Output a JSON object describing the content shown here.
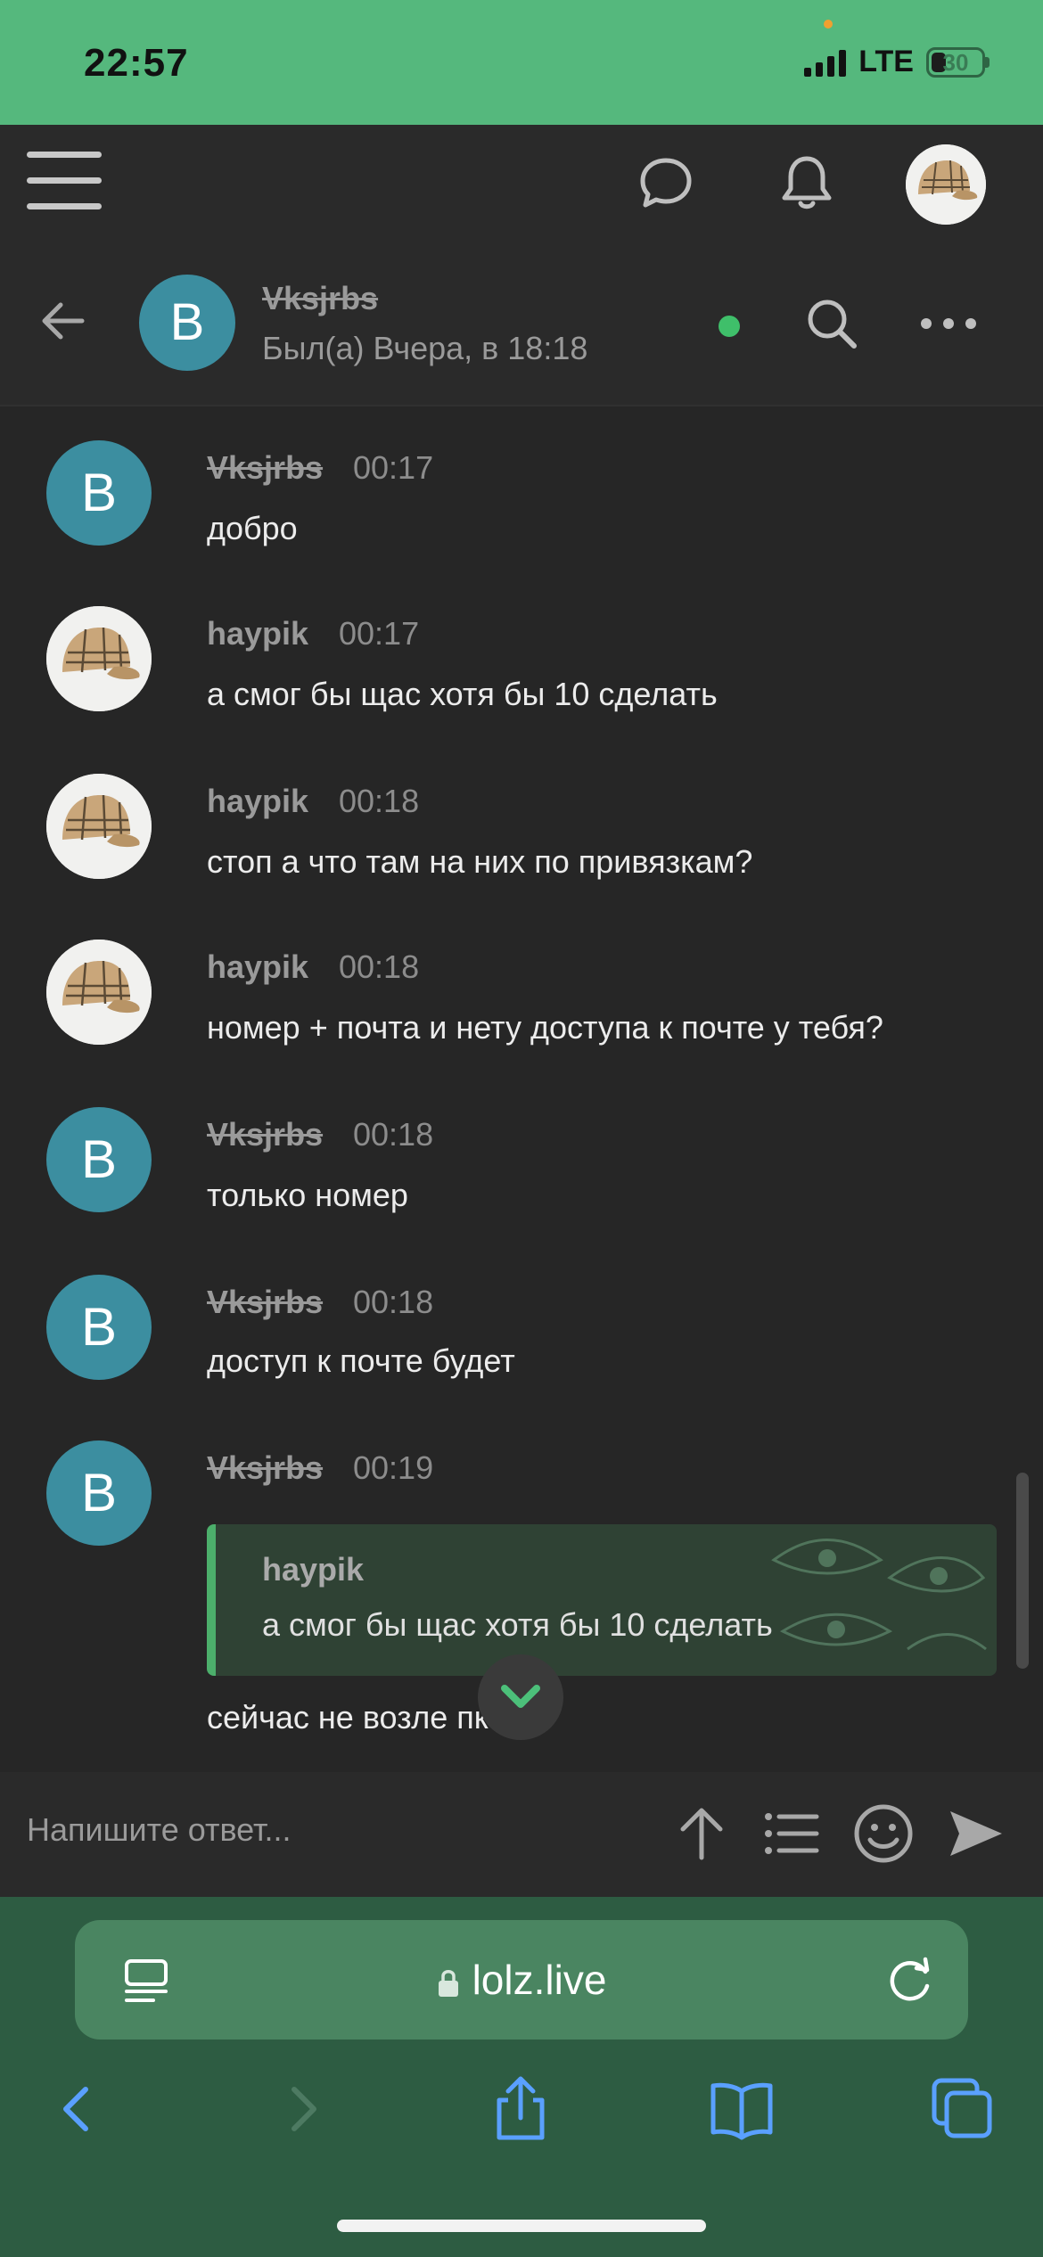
{
  "status_bar": {
    "time": "22:57",
    "network": "LTE",
    "battery": "30",
    "battery_level": 0.3,
    "colors": {
      "background": "#55b87d"
    }
  },
  "app_header": {
    "menu_icon": "hamburger-icon",
    "chat_icon": "speech-bubble-icon",
    "notifications_icon": "bell-icon",
    "profile_avatar": "cap-avatar"
  },
  "chat_header": {
    "avatar_letter": "B",
    "name": "Vksjrbs",
    "last_seen": "Был(а) Вчера, в 18:18",
    "online": true,
    "search_icon": "search-icon",
    "more_icon": "more-dots-icon"
  },
  "messages": [
    {
      "author": "Vksjrbs",
      "avatar": "letter",
      "avatar_letter": "B",
      "strikethrough": true,
      "time": "00:17",
      "text": "добро"
    },
    {
      "author": "haypik",
      "avatar": "cap",
      "strikethrough": false,
      "time": "00:17",
      "text": "а смог бы щас хотя бы 10 сделать"
    },
    {
      "author": "haypik",
      "avatar": "cap",
      "strikethrough": false,
      "time": "00:18",
      "text": "стоп а что там на них по привязкам?"
    },
    {
      "author": "haypik",
      "avatar": "cap",
      "strikethrough": false,
      "time": "00:18",
      "text": "номер + почта и нету доступа к почте у тебя?"
    },
    {
      "author": "Vksjrbs",
      "avatar": "letter",
      "avatar_letter": "B",
      "strikethrough": true,
      "time": "00:18",
      "text": "только номер"
    },
    {
      "author": "Vksjrbs",
      "avatar": "letter",
      "avatar_letter": "B",
      "strikethrough": true,
      "time": "00:18",
      "text": "доступ к почте будет"
    },
    {
      "author": "Vksjrbs",
      "avatar": "letter",
      "avatar_letter": "B",
      "strikethrough": true,
      "time": "00:19",
      "quote": {
        "author": "haypik",
        "text": "а смог бы щас хотя бы 10 сделать"
      },
      "text": "сейчас не возле пк"
    }
  ],
  "reply_bar": {
    "placeholder": "Напишите ответ...",
    "icons": [
      "upload-arrow-icon",
      "list-icon",
      "smiley-icon",
      "send-icon"
    ]
  },
  "browser": {
    "url": "lolz.live",
    "colors": {
      "background": "#2d5c42",
      "url_bar": "#4a8561",
      "accent": "#5aa0ff"
    },
    "nav": [
      "back-icon",
      "forward-icon",
      "share-icon",
      "bookmarks-icon",
      "tabs-icon"
    ]
  }
}
